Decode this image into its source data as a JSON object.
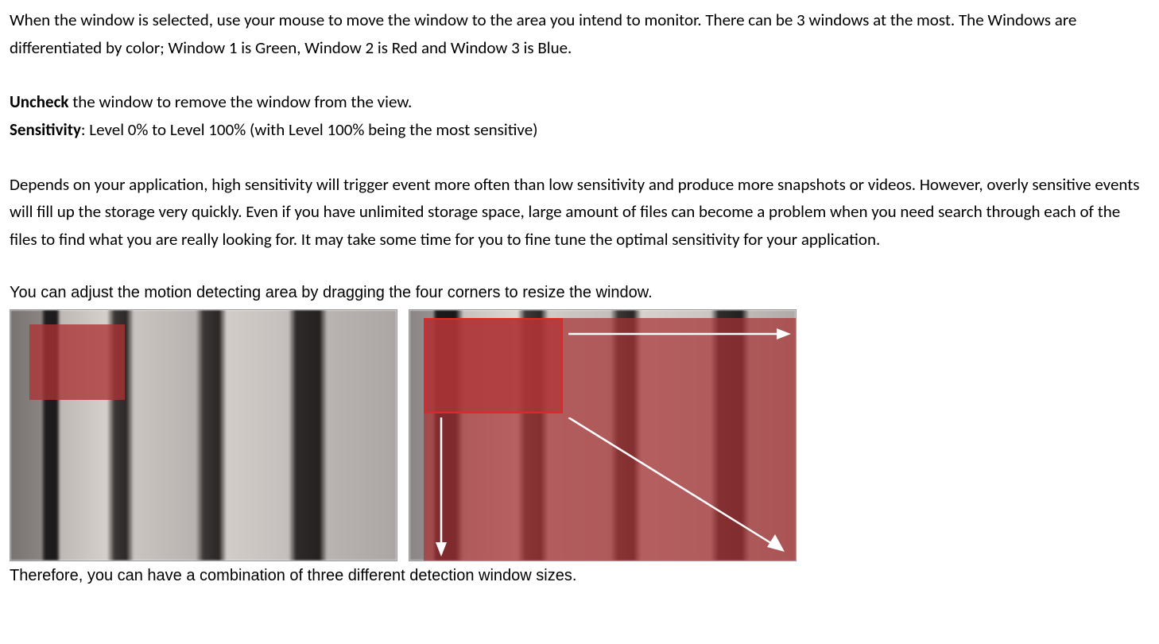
{
  "paragraphs": {
    "p1": "When the window is selected, use your mouse to move the window to the area you intend to monitor. There can be 3 windows at the most. The Windows are differentiated by color; Window 1 is Green, Window 2 is Red and Window 3 is Blue.",
    "p2_bold": "Uncheck",
    "p2_rest": " the window to remove the window from the view.",
    "p3_bold": "Sensitivity",
    "p3_rest": ": Level 0% to Level 100% (with Level 100% being the most sensitive)",
    "p4": "Depends on your application, high sensitivity will trigger event more often than low sensitivity and produce more snapshots or videos. However, overly sensitive events will fill up the storage very quickly. Even if you have unlimited storage space, large amount of files can become a problem when you need search through each of the files to find what you are really looking for. It may take some time for you to fine tune the optimal sensitivity for your application.",
    "p5": "You can adjust the motion detecting area by dragging the four corners to resize the window.",
    "p6": "Therefore, you can have a combination of three different detection window sizes."
  }
}
